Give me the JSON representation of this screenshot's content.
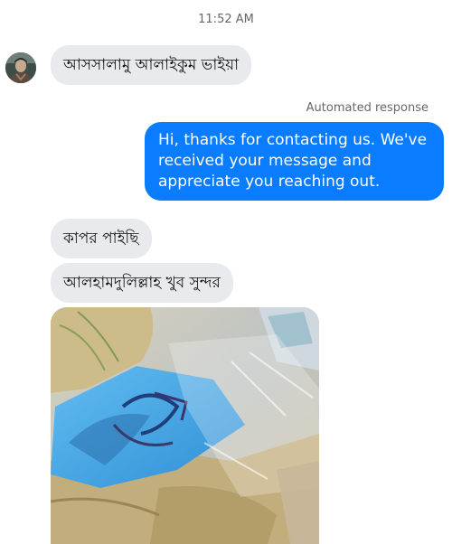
{
  "conversation": {
    "timestamp": "11:52 AM",
    "messages_in_top": [
      {
        "text": "আসসালামু আলাইকুম ভাইয়া"
      }
    ],
    "automated_label": "Automated response",
    "auto_reply": "Hi, thanks for contacting us. We've received your message and appreciate you reaching out.",
    "messages_in_bottom": [
      {
        "text": "কাপর পাইছি"
      },
      {
        "text": "আলহামদুলিল্লাহ খুব সুন্দর"
      }
    ],
    "photo": {
      "description_icon": "photo-attachment",
      "colors": {
        "cloth": "#4aa8e6",
        "sack": "#cbb98a",
        "background": "#bfc6c9"
      }
    }
  },
  "theme": {
    "outgoing_bubble": "#0a7cff",
    "incoming_bubble": "#e9eaee",
    "meta_text": "#65676b"
  }
}
